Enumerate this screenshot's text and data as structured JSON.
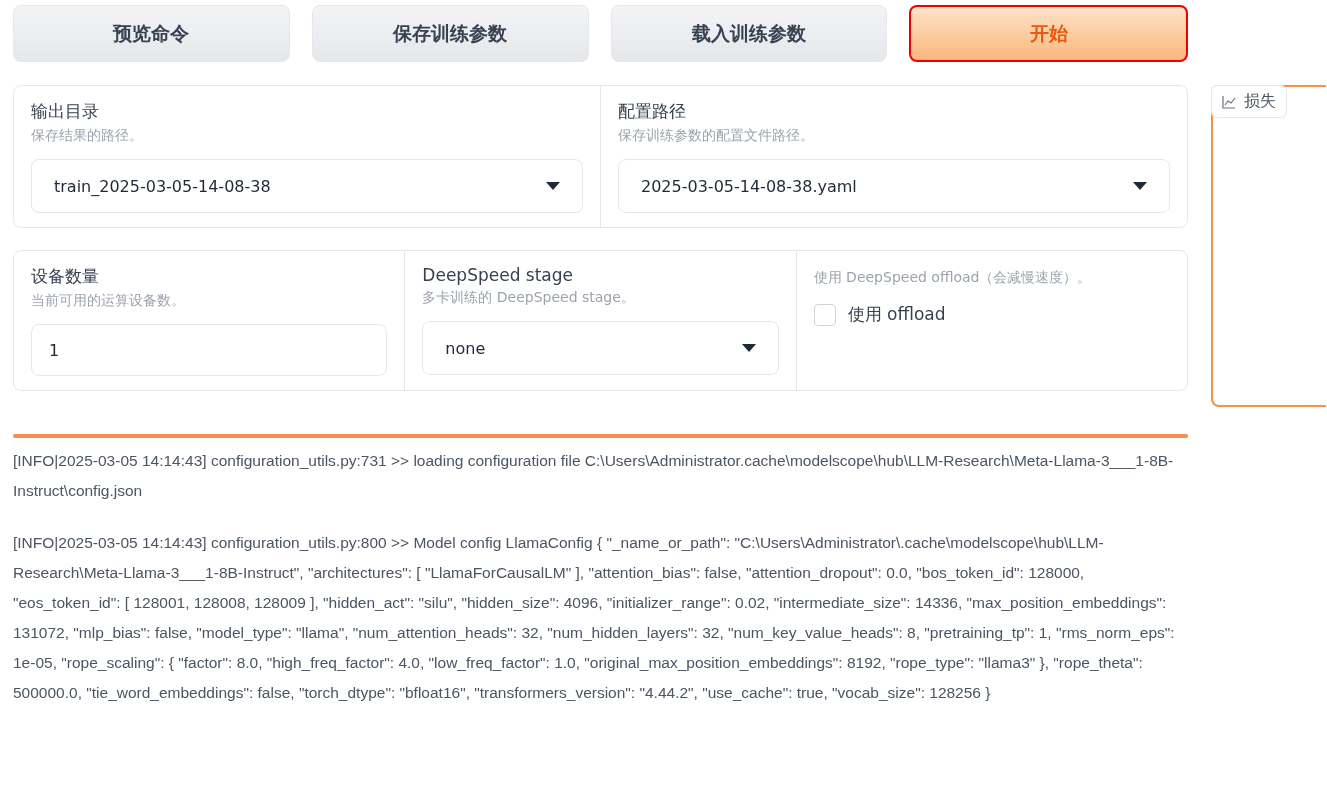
{
  "buttons": [
    {
      "label": "预览命令",
      "kind": "secondary",
      "highlighted": false
    },
    {
      "label": "保存训练参数",
      "kind": "secondary",
      "highlighted": false
    },
    {
      "label": "载入训练参数",
      "kind": "secondary",
      "highlighted": false
    },
    {
      "label": "开始",
      "kind": "primary",
      "highlighted": true
    }
  ],
  "cards": [
    {
      "fields": [
        {
          "kind": "dropdown",
          "label": "输出目录",
          "info": "保存结果的路径。",
          "value": "train_2025-03-05-14-08-38"
        },
        {
          "kind": "dropdown",
          "label": "配置路径",
          "info": "保存训练参数的配置文件路径。",
          "value": "2025-03-05-14-08-38.yaml"
        }
      ]
    },
    {
      "fields": [
        {
          "kind": "number",
          "label": "设备数量",
          "info": "当前可用的运算设备数。",
          "value": "1"
        },
        {
          "kind": "dropdown",
          "label": "DeepSpeed stage",
          "info": "多卡训练的 DeepSpeed stage。",
          "value": "none"
        },
        {
          "kind": "checkbox",
          "info": "使用 DeepSpeed offload（会减慢速度）。",
          "label": "使用 offload",
          "checked": false
        }
      ]
    }
  ],
  "progress": {
    "level": 1
  },
  "log": [
    "[INFO|2025-03-05 14:14:43] configuration_utils.py:731 >> loading configuration file C:\\Users\\Administrator.cache\\modelscope\\hub\\LLM-Research\\Meta-Llama-3___1-8B-Instruct\\config.json",
    "[INFO|2025-03-05 14:14:43] configuration_utils.py:800 >> Model config LlamaConfig { \"_name_or_path\": \"C:\\Users\\Administrator\\.cache\\modelscope\\hub\\LLM-Research\\Meta-Llama-3___1-8B-Instruct\", \"architectures\": [ \"LlamaForCausalLM\" ], \"attention_bias\": false, \"attention_dropout\": 0.0, \"bos_token_id\": 128000, \"eos_token_id\": [ 128001, 128008, 128009 ], \"hidden_act\": \"silu\", \"hidden_size\": 4096, \"initializer_range\": 0.02, \"intermediate_size\": 14336, \"max_position_embeddings\": 131072, \"mlp_bias\": false, \"model_type\": \"llama\", \"num_attention_heads\": 32, \"num_hidden_layers\": 32, \"num_key_value_heads\": 8, \"pretraining_tp\": 1, \"rms_norm_eps\": 1e-05, \"rope_scaling\": { \"factor\": 8.0, \"high_freq_factor\": 4.0, \"low_freq_factor\": 1.0, \"original_max_position_embeddings\": 8192, \"rope_type\": \"llama3\" }, \"rope_theta\": 500000.0, \"tie_word_embeddings\": false, \"torch_dtype\": \"bfloat16\", \"transformers_version\": \"4.44.2\", \"use_cache\": true, \"vocab_size\": 128256 }"
  ],
  "plot": {
    "label": "损失"
  }
}
